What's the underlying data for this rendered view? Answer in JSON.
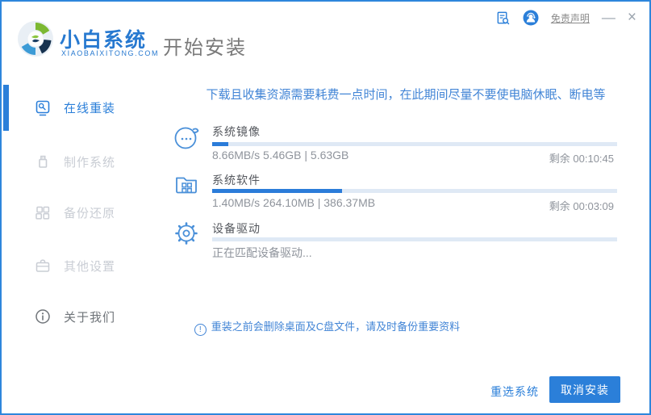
{
  "header": {
    "brand_name": "小白系统",
    "brand_domain": "XIAOBAIXITONG.COM",
    "page_title": "开始安装",
    "disclaimer_link": "免责声明"
  },
  "glyphs": {
    "minimize": "—",
    "close": "×",
    "exclamation": "!"
  },
  "sidebar": {
    "items": [
      {
        "label": "在线重装",
        "state": "active"
      },
      {
        "label": "制作系统",
        "state": "disabled"
      },
      {
        "label": "备份还原",
        "state": "disabled"
      },
      {
        "label": "其他设置",
        "state": "disabled"
      },
      {
        "label": "关于我们",
        "state": "normal"
      }
    ]
  },
  "main": {
    "warning": "下载且收集资源需要耗费一点时间，在此期间尽量不要使电脑休眠、断电等",
    "tasks": [
      {
        "name": "系统镜像",
        "progress_percent": 4,
        "detail": "8.66MB/s 5.46GB | 5.63GB",
        "remaining": "剩余 00:10:45"
      },
      {
        "name": "系统软件",
        "progress_percent": 32,
        "detail": "1.40MB/s 264.10MB | 386.37MB",
        "remaining": "剩余 00:03:09"
      },
      {
        "name": "设备驱动",
        "progress_percent": 0,
        "detail": "正在匹配设备驱动...",
        "remaining": ""
      }
    ],
    "note": "重装之前会删除桌面及C盘文件，请及时备份重要资料"
  },
  "footer": {
    "reselect_label": "重选系统",
    "cancel_label": "取消安装"
  },
  "colors": {
    "accent": "#2b7fd9",
    "window_border": "#2e86dc",
    "brand_blue": "#2779d0",
    "warning_text": "#4285d6",
    "bar_track": "#dfe9f5",
    "bar_fill": "#2b7cd9",
    "title_gray": "#7a7a7a",
    "label_dark": "#55585e",
    "detail_gray": "#8f949c",
    "disabled_gray": "#c9cdd4",
    "sidebar_about": "#6f7479",
    "link_gray": "#8a8a8a"
  }
}
